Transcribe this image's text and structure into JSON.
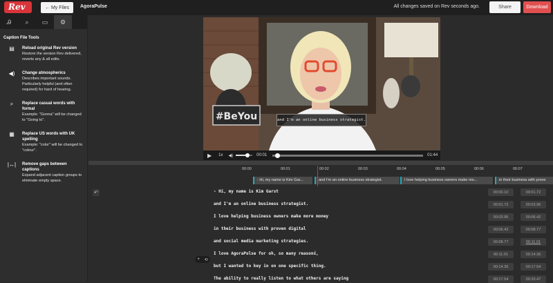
{
  "header": {
    "logo_text": "Rev",
    "my_files_label": "My Files",
    "document_title": "AgoraPulse",
    "save_status": "All changes saved on Rev seconds ago.",
    "share_label": "Share",
    "download_label": "Download"
  },
  "sidebar": {
    "tabs": [
      {
        "icon": "spellcheck-icon",
        "glyph": "Ꭿ"
      },
      {
        "icon": "search-icon",
        "glyph": "⌕"
      },
      {
        "icon": "keyboard-icon",
        "glyph": "▭"
      },
      {
        "icon": "gear-icon",
        "glyph": "⚙"
      }
    ],
    "heading": "Caption File Tools",
    "tools": [
      {
        "icon": "file-reload-icon",
        "title": "Reload original Rev version",
        "description": "Restore the version Rev delivered, reverts any & all edits."
      },
      {
        "icon": "sound-icon",
        "title": "Change atmospherics",
        "description": "Describes important sounds. Particularly helpful (and often required) for hard of hearing."
      },
      {
        "icon": "replace-search-icon",
        "title": "Replace casual words with formal",
        "description": "Example: \"Gonna\" will be changed to \"Going to\"."
      },
      {
        "icon": "flag-icon",
        "title": "Replace US words with UK spelling",
        "description": "Example: \"color\" will be changed to \"colour\"."
      },
      {
        "icon": "expand-icon",
        "title": "Remove gaps between captions",
        "description": "Expand adjacent caption groups to eliminate empty space."
      }
    ]
  },
  "video": {
    "sign_text": "#BeYou",
    "caption": "and I'm an online business strategist.",
    "speed": "1x",
    "current_time": "00:01",
    "duration": "01:44",
    "progress": 0.03,
    "volume": 0.7
  },
  "timeline": {
    "ticks": [
      "00:00",
      "00:01",
      "00:02",
      "00:03",
      "00:04",
      "00:05",
      "00:06",
      "00:07"
    ],
    "segments": [
      "- Hi, my name is Kim Gar...",
      "and I'm an online business strategist.",
      "I love helping business owners make mo...",
      "in their business with prove"
    ]
  },
  "transcript": {
    "lines": [
      {
        "text": "- Hi, my name is Kim Garst",
        "start": "00:00.10",
        "end": "00:01.72"
      },
      {
        "text": "and I'm an online business strategist.",
        "start": "00:01.72",
        "end": "00:03.96"
      },
      {
        "text": "I love helping business owners make more money",
        "start": "00:03.96",
        "end": "00:06.42"
      },
      {
        "text": "in their business with proven digital",
        "start": "00:06.42",
        "end": "00:08.77"
      },
      {
        "text": "and social media marketing strategies.",
        "start": "00:08.77",
        "end": "00:11.01"
      },
      {
        "text": "I love AgoraPulse for oh, so many reasons,",
        "start": "00:11.01",
        "end": "00:14.36"
      },
      {
        "text": "but I wanted to key in on one specific thing.",
        "start": "00:14.36",
        "end": "00:17.54"
      },
      {
        "text": "The ability to really listen to what others are saying",
        "start": "00:17.54",
        "end": "00:20.47"
      }
    ]
  },
  "colors": {
    "brand_red": "#d9343a",
    "accent_teal": "#2aa7b5"
  }
}
